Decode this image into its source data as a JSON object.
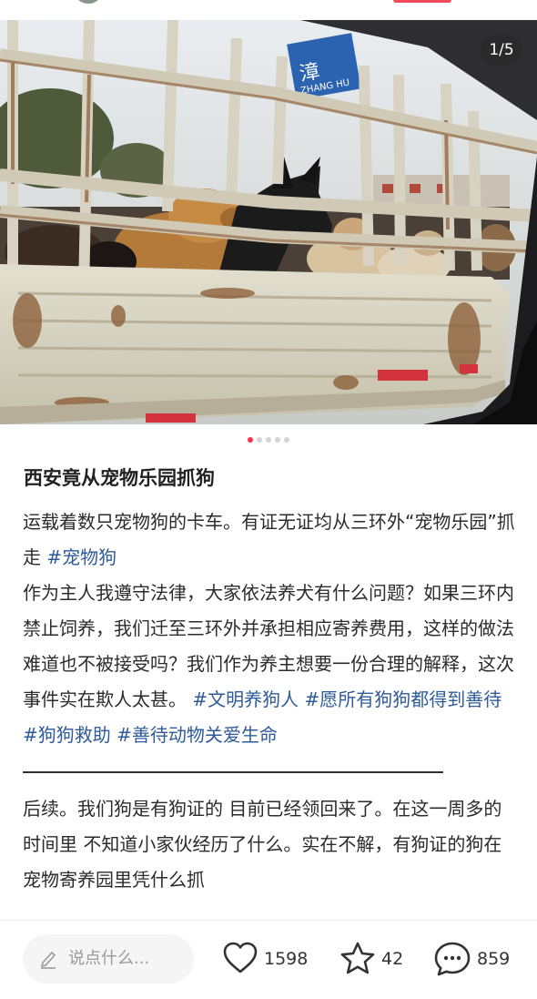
{
  "photo": {
    "counter": "1/5",
    "sign_text_cn": "漳",
    "sign_text_en": "ZHANG HU"
  },
  "carousel": {
    "total": 5,
    "active": 1
  },
  "post": {
    "title": "西安竟从宠物乐园抓狗",
    "line1": "运载着数只宠物狗的卡车。有证无证均从三环外“宠物乐园”抓走 ",
    "tag_pet": "#宠物狗",
    "para2": "作为主人我遵守法律，大家依法养犬有什么问题？如果三环内禁止饲养，我们迁至三环外并承担相应寄养费用，这样的做法难道也不被接受吗？我们作为养主想要一份合理的解释，这次事件实在欺人太甚。",
    "tag1": "#文明养狗人",
    "tag2": "#愿所有狗狗都得到善待",
    "tag3": "#狗狗救助",
    "tag4": "#善待动物关爱生命",
    "para3": "后续。我们狗是有狗证的 目前已经领回来了。在这一周多的时间里 不知道小家伙经历了什么。实在不解，有狗证的狗在宠物寄养园里凭什么抓"
  },
  "bottom": {
    "comment_placeholder": "说点什么...",
    "likes": "1598",
    "favorites": "42",
    "comments": "859"
  },
  "colors": {
    "accent": "#ff2e4d",
    "tag": "#2f5b9a",
    "truck_body": "#d9d6c6",
    "rust": "#8a5a33"
  }
}
